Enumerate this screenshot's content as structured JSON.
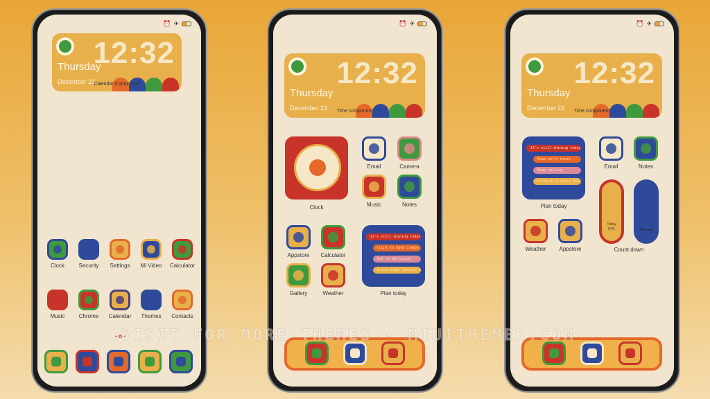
{
  "status_icons": [
    "alarm-icon",
    "airplane-icon",
    "battery-icon"
  ],
  "colors": {
    "screen": "#f1e5d0",
    "widget_yellow": "#e8b04a",
    "blue": "#2f4a9a",
    "red": "#c8332a",
    "green": "#3f9a3e",
    "orange": "#e4692a"
  },
  "phones": [
    {
      "widget": {
        "time": "12:32",
        "day": "Thursday",
        "date": "December 23",
        "caption": "Calendar Component"
      },
      "apps": [
        {
          "label": "Clock",
          "icon": "clock-icon",
          "color": "#2f4a9a",
          "bg": "#3f9a3e"
        },
        {
          "label": "Security",
          "icon": "shield-icon",
          "color": "#2f4a9a",
          "bg": "#2f4a9a"
        },
        {
          "label": "Settings",
          "icon": "gear-icon",
          "color": "#e4692a",
          "bg": "#e8b04a"
        },
        {
          "label": "Mi Video",
          "icon": "play-icon",
          "color": "#e8b04a",
          "bg": "#2f4a9a"
        },
        {
          "label": "Calculator",
          "icon": "calculator-icon",
          "color": "#c8332a",
          "bg": "#3f9a3e"
        },
        {
          "label": "Music",
          "icon": "music-icon",
          "color": "#c8332a",
          "bg": "#c8332a"
        },
        {
          "label": "Chrome",
          "icon": "chrome-icon",
          "color": "#3f9a3e",
          "bg": "#c8332a"
        },
        {
          "label": "Calendar",
          "icon": "calendar-icon",
          "color": "#4a3f7a",
          "bg": "#e8b04a"
        },
        {
          "label": "Themes",
          "icon": "palette-icon",
          "color": "#2f4a9a",
          "bg": "#2f4a9a"
        },
        {
          "label": "Contacts",
          "icon": "contacts-icon",
          "color": "#e4692a",
          "bg": "#e8b04a"
        }
      ],
      "dock": [
        {
          "icon": "phone-icon",
          "color": "#3f9a3e",
          "bg": "#e8b04a"
        },
        {
          "icon": "messages-icon",
          "color": "#c8332a",
          "bg": "#2f4a9a"
        },
        {
          "icon": "notes-icon",
          "color": "#2f4a9a",
          "bg": "#e4692a"
        },
        {
          "icon": "gallery-icon",
          "color": "#3f9a3e",
          "bg": "#e8b04a"
        },
        {
          "icon": "camera-icon",
          "color": "#2f4a9a",
          "bg": "#3f9a3e"
        }
      ]
    },
    {
      "widget": {
        "time": "12:32",
        "day": "Thursday",
        "date": "December 23",
        "caption": "Time component"
      },
      "clock_label": "Clock",
      "apps": [
        {
          "label": "Email",
          "icon": "email-icon",
          "color": "#2f4a9a",
          "bg": "#f6e7c6"
        },
        {
          "label": "Camera",
          "icon": "camera-icon",
          "color": "#d88a8a",
          "bg": "#3f9a3e"
        },
        {
          "label": "Music",
          "icon": "music-icon",
          "color": "#e8b04a",
          "bg": "#c8332a"
        },
        {
          "label": "Notes",
          "icon": "notes-icon",
          "color": "#3f9a3e",
          "bg": "#2f4a9a"
        },
        {
          "label": "Appstore",
          "icon": "appstore-icon",
          "color": "#2f4a9a",
          "bg": "#e8b04a"
        },
        {
          "label": "Calculator",
          "icon": "calculator-icon",
          "color": "#3f9a3e",
          "bg": "#c8332a"
        },
        {
          "label": "Gallery",
          "icon": "gallery-icon",
          "color": "#e8b04a",
          "bg": "#3f9a3e"
        },
        {
          "label": "Weather",
          "icon": "weather-icon",
          "color": "#c8332a",
          "bg": "#e8b04a"
        }
      ],
      "plan": {
        "label": "Plan today",
        "items": [
          "It's still shining today",
          "Count to hand cramps",
          "Eat to delicious",
          "Drink eight glasses of water"
        ],
        "colors": [
          "#c8332a",
          "#e4692a",
          "#d88a9a",
          "#e8b04a"
        ]
      },
      "dock": [
        {
          "icon": "messages-icon",
          "color": "#3f9a3e",
          "bg": "#c8332a"
        },
        {
          "icon": "contacts-icon",
          "color": "#f6e7c6",
          "bg": "#2f4a9a"
        },
        {
          "icon": "browser-icon",
          "color": "#c8332a",
          "bg": "#e8b04a"
        }
      ]
    },
    {
      "widget": {
        "time": "12:32",
        "day": "Thursday",
        "date": "December 23",
        "caption": "Time component"
      },
      "apps": [
        {
          "label": "Email",
          "icon": "email-icon",
          "color": "#2f4a9a",
          "bg": "#f6e7c6"
        },
        {
          "label": "Notes",
          "icon": "notes-icon",
          "color": "#3f9a3e",
          "bg": "#2f4a9a"
        },
        {
          "label": "Weather",
          "icon": "weather-icon",
          "color": "#c8332a",
          "bg": "#e8b04a"
        },
        {
          "label": "Appstore",
          "icon": "appstore-icon",
          "color": "#2f4a9a",
          "bg": "#e8b04a"
        }
      ],
      "plan": {
        "label": "Plan today",
        "items": [
          "It's still shining today",
          "Keep early hours",
          "Keep smiling",
          "Drink milk every day"
        ],
        "colors": [
          "#c8332a",
          "#e4692a",
          "#d88a9a",
          "#e8b04a"
        ]
      },
      "countdown": {
        "label": "Count down",
        "today_label": "Today",
        "today_value": "97%",
        "year_label": "This year"
      },
      "dock": [
        {
          "icon": "messages-icon",
          "color": "#3f9a3e",
          "bg": "#c8332a"
        },
        {
          "icon": "contacts-icon",
          "color": "#f6e7c6",
          "bg": "#2f4a9a"
        },
        {
          "icon": "browser-icon",
          "color": "#c8332a",
          "bg": "#e8b04a"
        }
      ]
    }
  ],
  "watermark": "VISIT FOR MORE THEMES - MIUITHEMER.COM"
}
